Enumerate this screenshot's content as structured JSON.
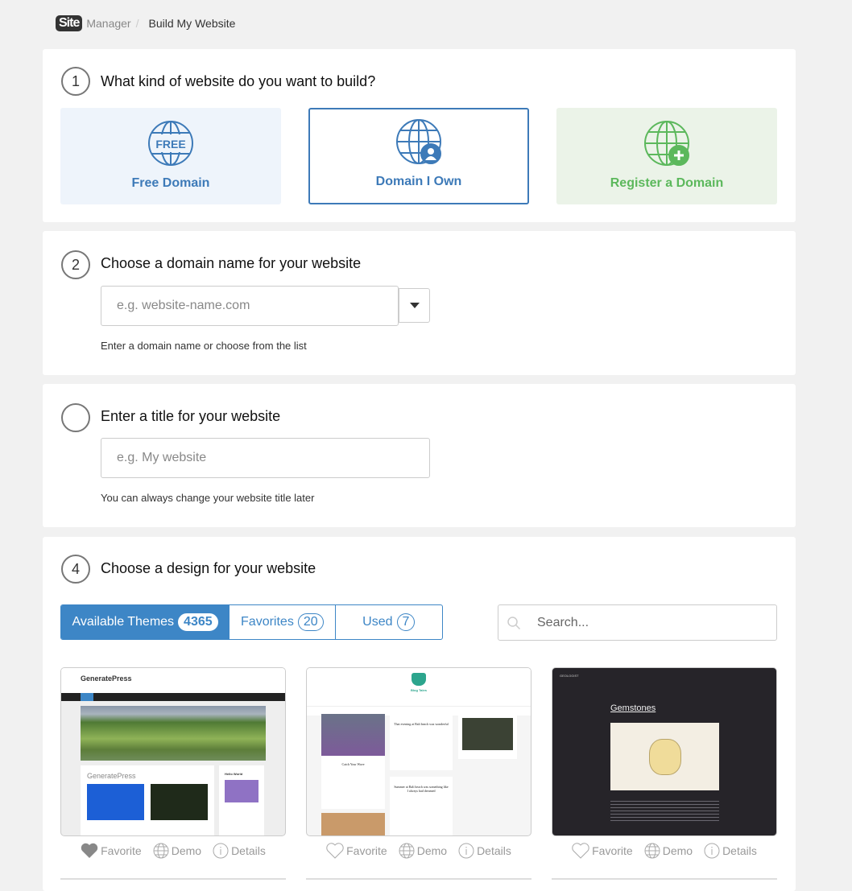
{
  "breadcrumb": {
    "logo": "Site",
    "section": "Manager",
    "separator": "/",
    "current": "Build My Website"
  },
  "step1": {
    "number": "1",
    "title": "What kind of website do you want to build?",
    "options": [
      {
        "label": "Free Domain",
        "icon": "globe-free-icon",
        "badge": "FREE",
        "color": "#3d7ab8",
        "bg": "#eef4fb"
      },
      {
        "label": "Domain I Own",
        "icon": "globe-user-icon",
        "color": "#3d7ab8",
        "bg": "#ffffff",
        "selected": true
      },
      {
        "label": "Register a Domain",
        "icon": "globe-plus-icon",
        "color": "#5cb85c",
        "bg": "#ebf3e8"
      }
    ]
  },
  "step2": {
    "number": "2",
    "title": "Choose a domain name for your website",
    "placeholder": "e.g. website-name.com",
    "help": "Enter a domain name or choose from the list"
  },
  "step3": {
    "number": "",
    "title": "Enter a title for your website",
    "placeholder": "e.g. My website",
    "help": "You can always change your website title later"
  },
  "step4": {
    "number": "4",
    "title": "Choose a design for your website",
    "tabs": [
      {
        "label": "Available Themes",
        "count": "4365",
        "active": true
      },
      {
        "label": "Favorites",
        "count": "20"
      },
      {
        "label": "Used",
        "count": "7"
      }
    ],
    "search_placeholder": "Search...",
    "themes": [
      {
        "name": "GeneratePress",
        "heading": "GeneratePress",
        "widget": "Hello World",
        "favorited": true
      },
      {
        "name": "Blog Tales",
        "post1": "Catch Your Wave",
        "post2": "That evening at Bali beach was wonderful",
        "post3": "Summer at Bali beach was something like I always had dreamed",
        "favorited": false
      },
      {
        "name": "Gemstones",
        "site": "GEOLOGIST",
        "favorited": false
      }
    ],
    "actions": {
      "favorite": "Favorite",
      "demo": "Demo",
      "details": "Details"
    }
  },
  "colors": {
    "accent": "#3d86c6",
    "green": "#5cb85c"
  }
}
